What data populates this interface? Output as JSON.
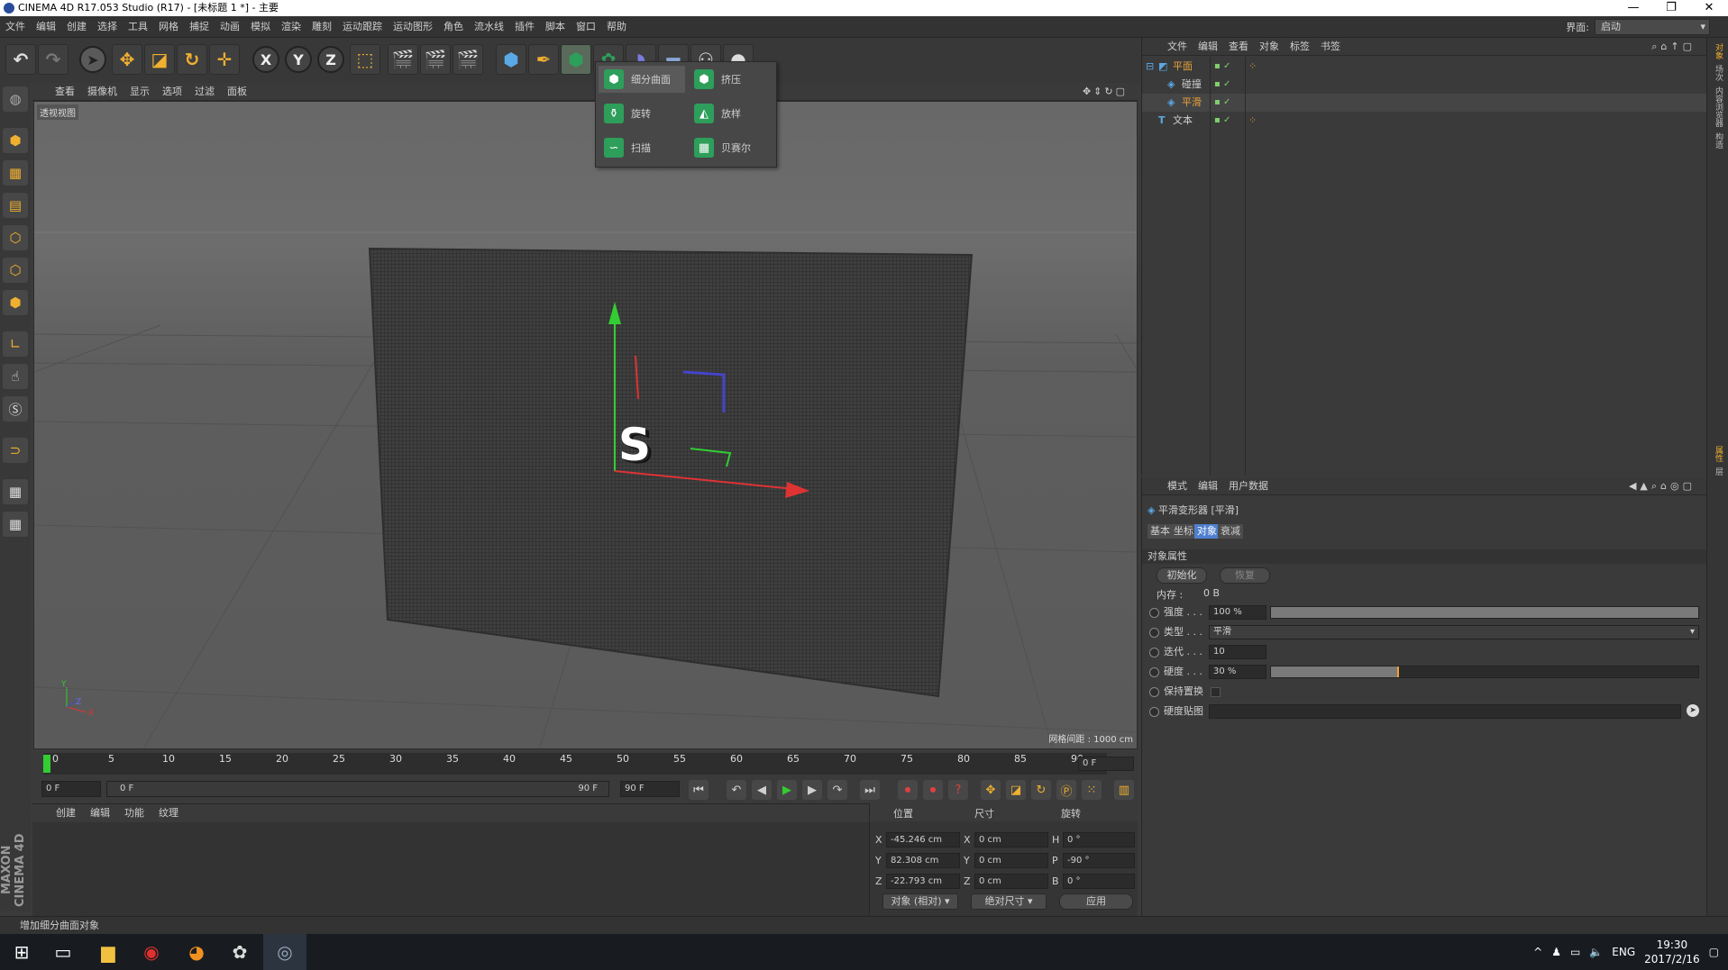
{
  "window": {
    "title": "CINEMA 4D R17.053 Studio (R17) - [未标题 1 *] - 主要",
    "minimize": "—",
    "restore": "❐",
    "close": "✕"
  },
  "menu": [
    "文件",
    "编辑",
    "创建",
    "选择",
    "工具",
    "网格",
    "捕捉",
    "动画",
    "模拟",
    "渲染",
    "雕刻",
    "运动跟踪",
    "运动图形",
    "角色",
    "流水线",
    "插件",
    "脚本",
    "窗口",
    "帮助"
  ],
  "layout": {
    "label": "界面:",
    "value": "启动"
  },
  "toolbar": {
    "x_label": "X",
    "y_label": "Y",
    "z_label": "Z"
  },
  "viewport": {
    "menu": [
      "查看",
      "摄像机",
      "显示",
      "选项",
      "过滤",
      "面板"
    ],
    "label": "透视视图",
    "grid_info": "网格间距 : 1000 cm",
    "axis_x": "X",
    "axis_y": "Y",
    "axis_z": "Z",
    "text_object": "S"
  },
  "popup": {
    "items": [
      {
        "label": "细分曲面",
        "icon": "subdivision-surface-icon",
        "color": "#2e9e5b"
      },
      {
        "label": "挤压",
        "icon": "extrude-icon",
        "color": "#2e9e5b"
      },
      {
        "label": "旋转",
        "icon": "lathe-icon",
        "color": "#2e9e5b"
      },
      {
        "label": "放样",
        "icon": "loft-icon",
        "color": "#2e9e5b"
      },
      {
        "label": "扫描",
        "icon": "sweep-icon",
        "color": "#2e9e5b"
      },
      {
        "label": "贝赛尔",
        "icon": "bezier-icon",
        "color": "#2e9e5b"
      }
    ]
  },
  "timeline": {
    "ticks": [
      "0",
      "5",
      "10",
      "15",
      "20",
      "25",
      "30",
      "35",
      "40",
      "45",
      "50",
      "55",
      "60",
      "65",
      "70",
      "75",
      "80",
      "85",
      "90"
    ],
    "current_frame_label": "0 F",
    "start": "0 F",
    "range_start": "0 F",
    "range_end": "90 F",
    "end": "90 F"
  },
  "material": {
    "menu": [
      "创建",
      "编辑",
      "功能",
      "纹理"
    ],
    "brand": "MAXON CINEMA 4D"
  },
  "coords": {
    "headers": {
      "position": "位置",
      "size": "尺寸",
      "rotation": "旋转"
    },
    "rows": [
      {
        "axis": "X",
        "pos": "-45.246 cm",
        "size_axis": "X",
        "size": "0 cm",
        "rot_axis": "H",
        "rot": "0 °"
      },
      {
        "axis": "Y",
        "pos": "82.308 cm",
        "size_axis": "Y",
        "size": "0 cm",
        "rot_axis": "P",
        "rot": "-90 °"
      },
      {
        "axis": "Z",
        "pos": "-22.793 cm",
        "size_axis": "Z",
        "size": "0 cm",
        "rot_axis": "B",
        "rot": "0 °"
      }
    ],
    "mode": "对象 (相对)",
    "size_mode": "绝对尺寸",
    "apply": "应用"
  },
  "status": "增加细分曲面对象",
  "objects": {
    "menu": [
      "文件",
      "编辑",
      "查看",
      "对象",
      "标签",
      "书签"
    ],
    "items": [
      {
        "name": "平面",
        "color": "#e8a23a"
      },
      {
        "name": "碰撞",
        "color": "#cfcfcf"
      },
      {
        "name": "平滑",
        "color": "#e8a23a"
      },
      {
        "name": "文本",
        "color": "#cfcfcf"
      }
    ]
  },
  "attributes": {
    "menu": [
      "模式",
      "编辑",
      "用户数据"
    ],
    "title": "平滑变形器 [平滑]",
    "tabs": [
      "基本",
      "坐标",
      "对象",
      "衰减"
    ],
    "section": "对象属性",
    "init_button": "初始化",
    "restore_button": "恢复",
    "memory_label": "内存 :",
    "memory_value": "0 B",
    "strength_label": "强度 . . .",
    "strength_value": "100 %",
    "strength_fraction": 1.0,
    "type_label": "类型 . . .",
    "type_value": "平滑",
    "iterations_label": "迭代 . . .",
    "iterations_value": "10",
    "stiffness_label": "硬度 . . .",
    "stiffness_value": "30 %",
    "stiffness_fraction": 0.3,
    "keep_replace_label": "保持置换",
    "stiffness_map_label": "硬度贴图"
  },
  "right_strip": [
    "对象",
    "场次",
    "内容浏览器",
    "构造",
    "属性",
    "层"
  ],
  "taskbar": {
    "time": "19:30",
    "date": "2017/2/16",
    "lang": "ENG"
  }
}
